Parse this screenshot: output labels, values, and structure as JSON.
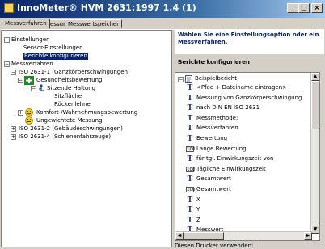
{
  "window": {
    "title": "InnoMeter® HVM 2631:1997 1.4 (1)"
  },
  "tabs": [
    "Messverfahren",
    "Messung",
    "Messwertspeicher"
  ],
  "tree": {
    "einstellungen": "Einstellungen",
    "sensor": "Sensor-Einstellungen",
    "berichte": "Berichte konfigurieren",
    "messverfahren": "Messverfahren",
    "iso1": "ISO 2631-1 (Ganzkörperschwingungen)",
    "gesundheit": "Gesundheitsbewertung",
    "sitzende": "Sitzende Haltung",
    "sitzflaeche": "Sitzfläche",
    "rueckenlehne": "Rückenlehne",
    "komfort": "Komfort-/Wahrnehmungsbewertung",
    "ungewichtet": "Ungewichtete Messung",
    "iso2": "ISO 2631-2 (Gebäudeschwingungen)",
    "iso4": "ISO 2631-4 (Schienenfahrzeuge)"
  },
  "help_text": "Wählen Sie eine Einstellungsoption oder ein Messverfahren.",
  "section_title": "Berichte konfigurieren",
  "report": {
    "root": "Beispielbericht",
    "items": [
      {
        "icon": "text-field-icon",
        "label": "<Pfad + Dateiname eintragen>"
      },
      {
        "icon": "text-field-icon",
        "label": "Messung von Ganzkörperschwingung"
      },
      {
        "icon": "text-field-icon",
        "label": "nach DIN EN ISO 2631"
      },
      {
        "icon": "text-field-icon",
        "label": "Messmethode:"
      },
      {
        "icon": "text-field-icon",
        "label": "Messverfahren"
      },
      {
        "icon": "text-field-icon",
        "label": "Bewertung"
      },
      {
        "icon": "number-field-icon",
        "label": "Lange Bewertung"
      },
      {
        "icon": "text-field-icon",
        "label": "für tgl. Einwirkungszeit von"
      },
      {
        "icon": "number-field-icon",
        "label": "Tägliche Einwirkungszeit"
      },
      {
        "icon": "text-field-icon",
        "label": "Gesamtwert"
      },
      {
        "icon": "number-field-icon",
        "label": "Gesamtwert"
      },
      {
        "icon": "text-field-icon",
        "label": "X"
      },
      {
        "icon": "text-field-icon",
        "label": "Y"
      },
      {
        "icon": "text-field-icon",
        "label": "Z"
      },
      {
        "icon": "text-field-icon",
        "label": "Messwert"
      }
    ]
  },
  "footer": "Diesen Drucker verwenden:"
}
